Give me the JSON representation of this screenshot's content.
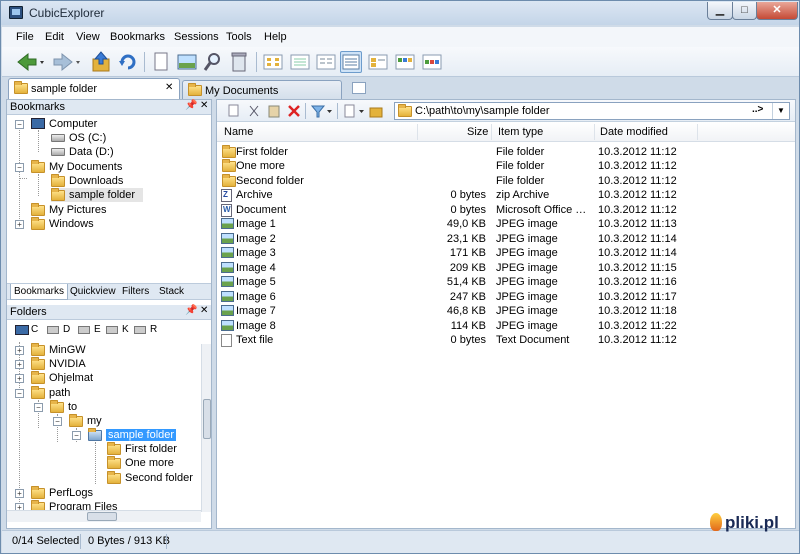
{
  "window": {
    "title": "CubicExplorer",
    "controls": {
      "minimize": "▁",
      "maximize": "□",
      "close": "✕"
    }
  },
  "menu": [
    "File",
    "Edit",
    "View",
    "Bookmarks",
    "Sessions",
    "Tools",
    "Help"
  ],
  "toolbar": {
    "buttons": [
      "back-icon",
      "forward-icon",
      "up-folder-icon",
      "refresh-icon",
      "page-icon",
      "image-icon",
      "search-icon",
      "recycle-bin-icon",
      "view-large-icons-icon",
      "view-small-icons-icon",
      "view-list-icon",
      "view-details-icon",
      "view-tiles-icon",
      "view-thumbnails-icon",
      "view-filmstrip-icon"
    ],
    "active_view": "view-details-icon"
  },
  "tabs": [
    {
      "label": "sample folder",
      "active": true
    },
    {
      "label": "My Documents",
      "active": false
    }
  ],
  "bookmarks": {
    "title": "Bookmarks",
    "pin": "📌",
    "close": "✕",
    "items": [
      {
        "label": "Computer",
        "icon": "computer-icon"
      },
      {
        "label": "OS (C:)",
        "icon": "drive-icon"
      },
      {
        "label": "Data (D:)",
        "icon": "drive-icon"
      },
      {
        "label": "My Documents",
        "icon": "folder-icon"
      },
      {
        "label": "Downloads",
        "icon": "folder-download-icon"
      },
      {
        "label": "sample folder",
        "icon": "folder-icon",
        "selected": true
      },
      {
        "label": "My Pictures",
        "icon": "folder-icon"
      },
      {
        "label": "Windows",
        "icon": "folder-icon"
      }
    ]
  },
  "subtabs": [
    "Bookmarks",
    "Quickview",
    "Filters",
    "Stack"
  ],
  "folders": {
    "title": "Folders",
    "drives": [
      "C",
      "D",
      "E",
      "K",
      "R"
    ],
    "items": [
      {
        "label": "MinGW"
      },
      {
        "label": "NVIDIA"
      },
      {
        "label": "Ohjelmat"
      },
      {
        "label": "path"
      },
      {
        "label": "to"
      },
      {
        "label": "my"
      },
      {
        "label": "sample folder",
        "selected": true
      },
      {
        "label": "First folder"
      },
      {
        "label": "One more"
      },
      {
        "label": "Second folder"
      },
      {
        "label": "PerfLogs"
      },
      {
        "label": "Program Files"
      }
    ]
  },
  "address": {
    "path": "C:\\path\\to\\my\\sample folder",
    "go": "..>",
    "dropdown": "▼"
  },
  "columns": {
    "name": "Name",
    "size": "Size",
    "type": "Item type",
    "date": "Date modified"
  },
  "files": [
    {
      "name": "First folder",
      "size": "",
      "type": "File folder",
      "date": "10.3.2012 11:12",
      "icon": "folder-icon"
    },
    {
      "name": "One more",
      "size": "",
      "type": "File folder",
      "date": "10.3.2012 11:12",
      "icon": "folder-icon"
    },
    {
      "name": "Second folder",
      "size": "",
      "type": "File folder",
      "date": "10.3.2012 11:12",
      "icon": "folder-icon"
    },
    {
      "name": "Archive",
      "size": "0 bytes",
      "type": "zip Archive",
      "date": "10.3.2012 11:12",
      "icon": "zip-icon"
    },
    {
      "name": "Document",
      "size": "0 bytes",
      "type": "Microsoft Office W...",
      "date": "10.3.2012 11:12",
      "icon": "word-doc-icon"
    },
    {
      "name": "Image 1",
      "size": "49,0 KB",
      "type": "JPEG image",
      "date": "10.3.2012 11:13",
      "icon": "image-icon"
    },
    {
      "name": "Image 2",
      "size": "23,1 KB",
      "type": "JPEG image",
      "date": "10.3.2012 11:14",
      "icon": "image-icon"
    },
    {
      "name": "Image 3",
      "size": "171 KB",
      "type": "JPEG image",
      "date": "10.3.2012 11:14",
      "icon": "image-icon"
    },
    {
      "name": "Image 4",
      "size": "209 KB",
      "type": "JPEG image",
      "date": "10.3.2012 11:15",
      "icon": "image-icon"
    },
    {
      "name": "Image 5",
      "size": "51,4 KB",
      "type": "JPEG image",
      "date": "10.3.2012 11:16",
      "icon": "image-icon"
    },
    {
      "name": "Image 6",
      "size": "247 KB",
      "type": "JPEG image",
      "date": "10.3.2012 11:17",
      "icon": "image-icon"
    },
    {
      "name": "Image 7",
      "size": "46,8 KB",
      "type": "JPEG image",
      "date": "10.3.2012 11:18",
      "icon": "image-icon"
    },
    {
      "name": "Image 8",
      "size": "114 KB",
      "type": "JPEG image",
      "date": "10.3.2012 11:22",
      "icon": "image-icon"
    },
    {
      "name": "Text file",
      "size": "0 bytes",
      "type": "Text Document",
      "date": "10.3.2012 11:12",
      "icon": "text-file-icon"
    }
  ],
  "status": {
    "selected": "0/14 Selected",
    "bytes": "0 Bytes / 913 KB"
  },
  "watermark": "pliki.pl"
}
